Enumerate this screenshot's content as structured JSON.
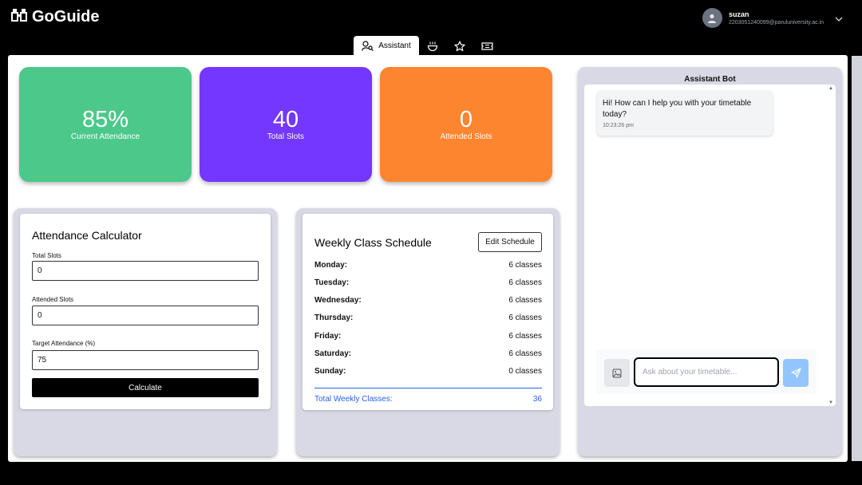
{
  "app": {
    "name": "GoGuide"
  },
  "user": {
    "name": "suzan",
    "email": "2203051240099@paruluniversity.ac.in"
  },
  "tabs": {
    "assistant_label": "Assistant"
  },
  "stats": {
    "current_attendance": {
      "value": "85%",
      "label": "Current Attendance",
      "color": "#4cc98a"
    },
    "total_slots": {
      "value": "40",
      "label": "Total Slots",
      "color": "#7337ff"
    },
    "attended_slots": {
      "value": "0",
      "label": "Attended Slots",
      "color": "#fd8530"
    }
  },
  "calculator": {
    "title": "Attendance Calculator",
    "total_label": "Total Slots",
    "total_value": "0",
    "attended_label": "Attended Slots",
    "attended_value": "0",
    "target_label": "Target Attendance (%)",
    "target_value": "75",
    "button_label": "Calculate"
  },
  "schedule": {
    "title": "Weekly Class Schedule",
    "edit_label": "Edit Schedule",
    "days": [
      {
        "day": "Monday:",
        "count": "6 classes"
      },
      {
        "day": "Tuesday:",
        "count": "6 classes"
      },
      {
        "day": "Wednesday:",
        "count": "6 classes"
      },
      {
        "day": "Thursday:",
        "count": "6 classes"
      },
      {
        "day": "Friday:",
        "count": "6 classes"
      },
      {
        "day": "Saturday:",
        "count": "6 classes"
      },
      {
        "day": "Sunday:",
        "count": "0 classes"
      }
    ],
    "total_label": "Total Weekly Classes:",
    "total_value": "36"
  },
  "chat": {
    "title": "Assistant Bot",
    "message": "Hi! How can I help you with your timetable today?",
    "time": "10:23:26 pm",
    "input_placeholder": "Ask about your timetable..."
  }
}
